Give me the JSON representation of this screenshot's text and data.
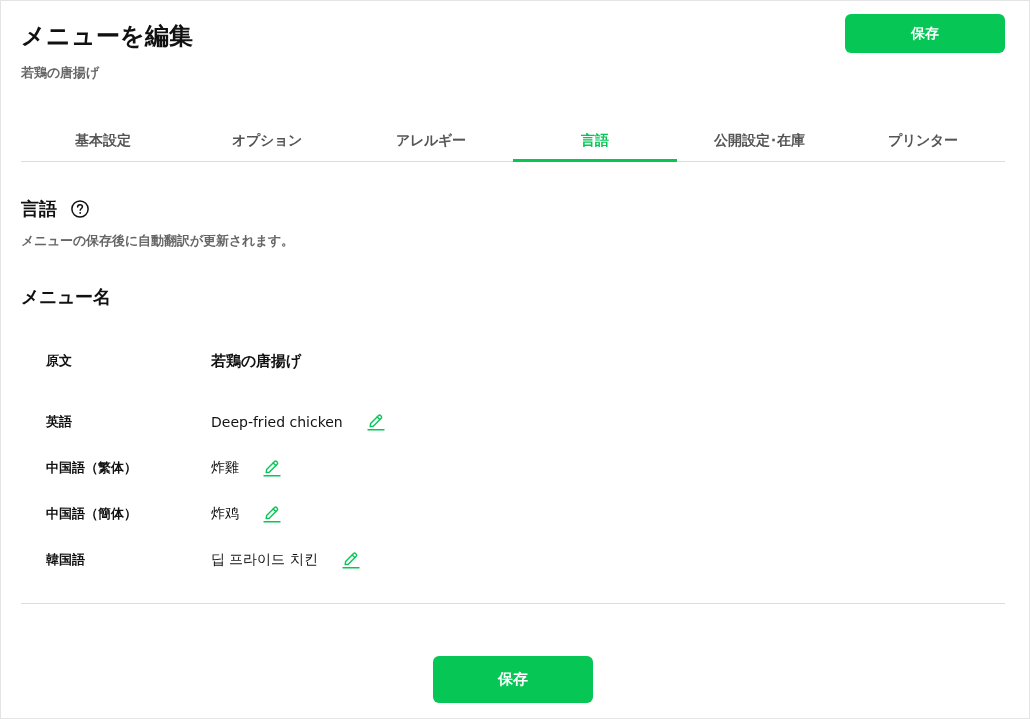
{
  "header": {
    "title": "メニューを編集",
    "subtitle": "若鶏の唐揚げ",
    "save_button": "保存"
  },
  "tabs": [
    {
      "label": "基本設定",
      "selected": false
    },
    {
      "label": "オプション",
      "selected": false
    },
    {
      "label": "アレルギー",
      "selected": false
    },
    {
      "label": "言語",
      "selected": true
    },
    {
      "label": "公開設定･在庫",
      "selected": false
    },
    {
      "label": "プリンター",
      "selected": false
    }
  ],
  "section": {
    "title": "言語",
    "description": "メニューの保存後に自動翻訳が更新されます。"
  },
  "menu_name": {
    "title": "メニュー名",
    "rows": [
      {
        "kind": "original",
        "label": "原文",
        "value": "若鶏の唐揚げ"
      },
      {
        "kind": "translation",
        "label": "英語",
        "value": "Deep-fried chicken"
      },
      {
        "kind": "translation",
        "label": "中国語（繁体）",
        "value": "炸雞"
      },
      {
        "kind": "translation",
        "label": "中国語（簡体）",
        "value": "炸鸡"
      },
      {
        "kind": "translation",
        "label": "韓国語",
        "value": "딥 프라이드 치킨"
      }
    ]
  },
  "footer": {
    "save_button": "保存"
  }
}
